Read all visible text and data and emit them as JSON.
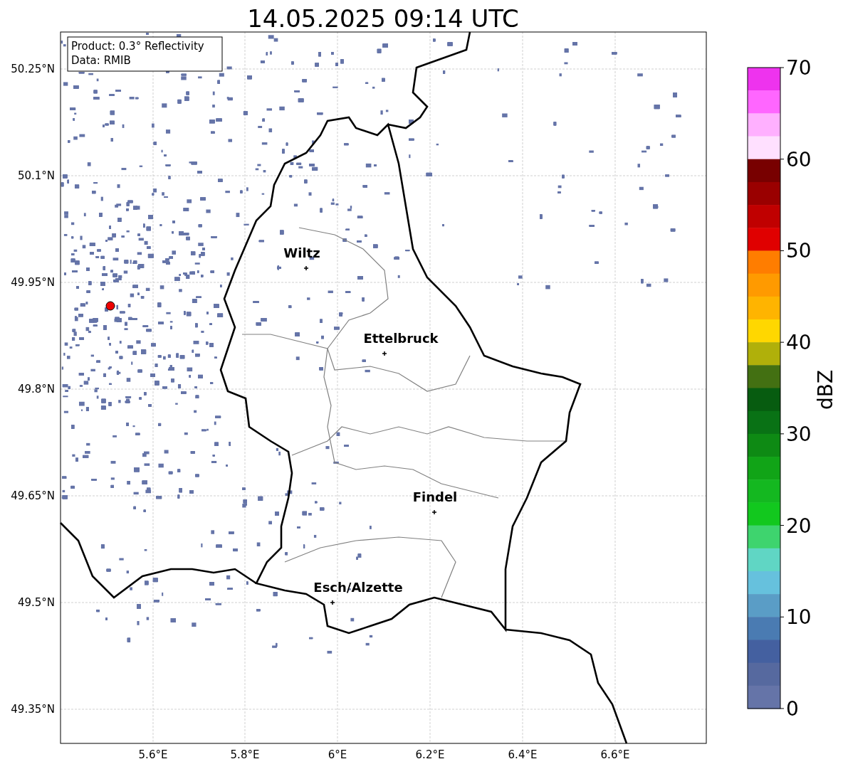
{
  "title": "14.05.2025 09:14 UTC",
  "info_box": [
    "Product: 0.3° Reflectivity",
    "Data: RMIB"
  ],
  "y_ticks": [
    "50.25°N",
    "50.1°N",
    "49.95°N",
    "49.8°N",
    "49.65°N",
    "49.5°N",
    "49.35°N"
  ],
  "x_ticks": [
    "5.6°E",
    "5.8°E",
    "6°E",
    "6.2°E",
    "6.4°E",
    "6.6°E"
  ],
  "cities": [
    {
      "name": "Wiltz"
    },
    {
      "name": "Ettelbruck"
    },
    {
      "name": "Findel"
    },
    {
      "name": "Esch/Alzette"
    }
  ],
  "colorbar": {
    "label": "dBZ",
    "ticks": [
      "70",
      "60",
      "50",
      "40",
      "30",
      "20",
      "10",
      "0"
    ],
    "bins": [
      {
        "color": "#ee33ee"
      },
      {
        "color": "#ff66ff"
      },
      {
        "color": "#ffb0ff"
      },
      {
        "color": "#ffe0ff"
      },
      {
        "color": "#780000"
      },
      {
        "color": "#9a0000"
      },
      {
        "color": "#c00000"
      },
      {
        "color": "#e00000"
      },
      {
        "color": "#ff7d00"
      },
      {
        "color": "#ff9a00"
      },
      {
        "color": "#ffb400"
      },
      {
        "color": "#ffd700"
      },
      {
        "color": "#b0b00a"
      },
      {
        "color": "#437012"
      },
      {
        "color": "#075c10"
      },
      {
        "color": "#097215"
      },
      {
        "color": "#0e8a14"
      },
      {
        "color": "#11a417"
      },
      {
        "color": "#14b820"
      },
      {
        "color": "#12c81e"
      },
      {
        "color": "#3ed46e"
      },
      {
        "color": "#60d6c4"
      },
      {
        "color": "#66c1dd"
      },
      {
        "color": "#5a9dc6"
      },
      {
        "color": "#4a7bb2"
      },
      {
        "color": "#4460a0"
      },
      {
        "color": "#56699f"
      },
      {
        "color": "#6574a8"
      }
    ]
  }
}
